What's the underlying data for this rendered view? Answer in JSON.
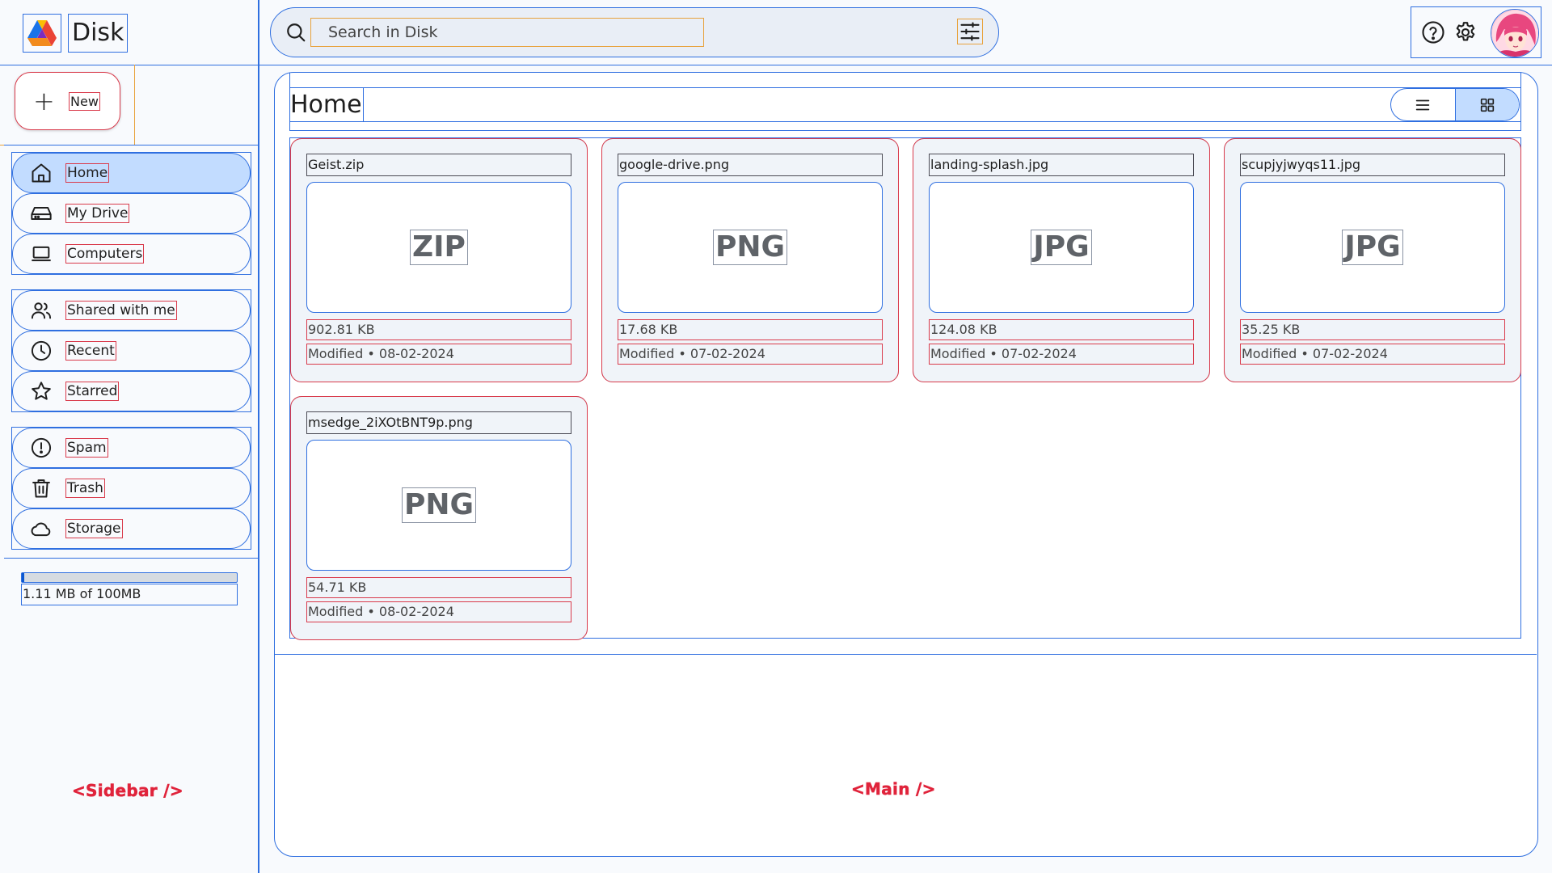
{
  "app": {
    "name": "Disk"
  },
  "sidebar": {
    "new_label": "New",
    "groups": [
      [
        {
          "label": "Home",
          "icon": "home-icon",
          "active": true
        },
        {
          "label": "My Drive",
          "icon": "drive-icon",
          "active": false
        },
        {
          "label": "Computers",
          "icon": "computer-icon",
          "active": false
        }
      ],
      [
        {
          "label": "Shared with me",
          "icon": "people-icon",
          "active": false
        },
        {
          "label": "Recent",
          "icon": "clock-icon",
          "active": false
        },
        {
          "label": "Starred",
          "icon": "star-icon",
          "active": false
        }
      ],
      [
        {
          "label": "Spam",
          "icon": "alert-icon",
          "active": false
        },
        {
          "label": "Trash",
          "icon": "trash-icon",
          "active": false
        },
        {
          "label": "Storage",
          "icon": "cloud-icon",
          "active": false
        }
      ]
    ],
    "storage": {
      "text": "1.11 MB of 100MB",
      "used_fraction": 0.0111
    },
    "tag": "<Sidebar />"
  },
  "search": {
    "placeholder": "Search in Disk"
  },
  "main": {
    "title": "Home",
    "view": "grid",
    "tag": "<Main />",
    "files": [
      {
        "name": "Geist.zip",
        "type": "ZIP",
        "size": "902.81 KB",
        "modified": "Modified • 08-02-2024"
      },
      {
        "name": "google-drive.png",
        "type": "PNG",
        "size": "17.68 KB",
        "modified": "Modified • 07-02-2024"
      },
      {
        "name": "landing-splash.jpg",
        "type": "JPG",
        "size": "124.08 KB",
        "modified": "Modified • 07-02-2024"
      },
      {
        "name": "scupjyjwyqs11.jpg",
        "type": "JPG",
        "size": "35.25 KB",
        "modified": "Modified • 07-02-2024"
      },
      {
        "name": "msedge_2iXOtBNT9p.png",
        "type": "PNG",
        "size": "54.71 KB",
        "modified": "Modified • 08-02-2024"
      }
    ]
  },
  "colors": {
    "accent": "#2f6fe0",
    "active_bg": "#c2dcff",
    "outline_red": "#d93a4b",
    "outline_orange": "#e8a23c"
  }
}
